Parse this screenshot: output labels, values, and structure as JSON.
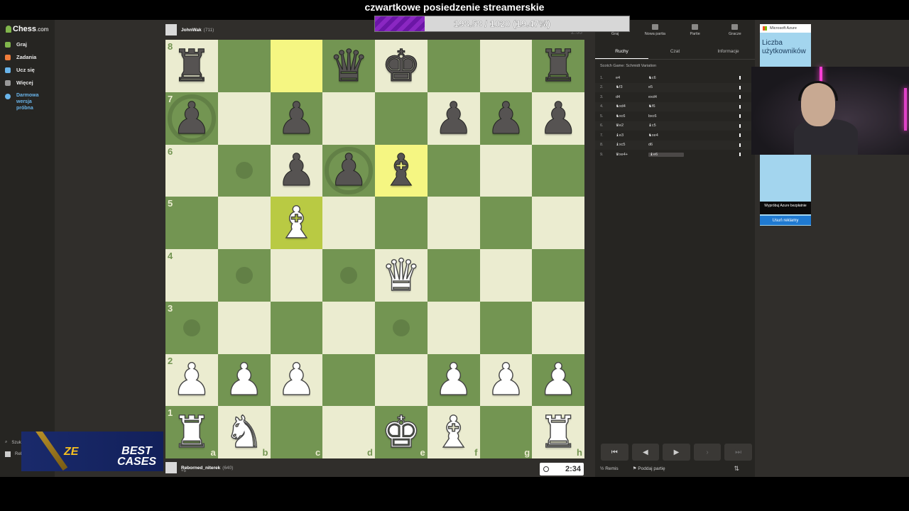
{
  "stream": {
    "title": "czwartkowe posiedzenie streamerskie",
    "goal_text": "198.58 / 1020 (19.47%)",
    "goal_fraction": 0.1947
  },
  "nav": {
    "logo": "Chess",
    "logo_suffix": ".com",
    "items": [
      {
        "label": "Graj",
        "color": "#81b64c"
      },
      {
        "label": "Zadania",
        "color": "#f07d3b"
      },
      {
        "label": "Ucz się",
        "color": "#69b4ea"
      },
      {
        "label": "Więcej",
        "color": "#999999"
      }
    ],
    "free_trial": "Darmowa\nwersja\npróbna",
    "search": "Szuk",
    "user_short": "Reb"
  },
  "top_player": {
    "name": "JohnWak",
    "rating": "(711)",
    "clock_hint": "2:55"
  },
  "bottom_player": {
    "name": "Reborned_niterek",
    "rating": "(640)",
    "sub": "+5",
    "clock": "2:34"
  },
  "board": {
    "files": [
      "a",
      "b",
      "c",
      "d",
      "e",
      "f",
      "g",
      "h"
    ],
    "ranks": [
      "8",
      "7",
      "6",
      "5",
      "4",
      "3",
      "2",
      "1"
    ],
    "rows": [
      [
        "br",
        "",
        "",
        "bq",
        "bk",
        "",
        "",
        "br"
      ],
      [
        "bp",
        "",
        "bp",
        "",
        "",
        "bp",
        "bp",
        "bp"
      ],
      [
        "",
        "",
        "bp",
        "bp",
        "bb",
        "",
        "",
        ""
      ],
      [
        "",
        "",
        "wb",
        "",
        "",
        "",
        "",
        ""
      ],
      [
        "",
        "",
        "",
        "",
        "wq",
        "",
        "",
        ""
      ],
      [
        "",
        "",
        "",
        "",
        "",
        "",
        "",
        ""
      ],
      [
        "wp",
        "wp",
        "wp",
        "",
        "",
        "wp",
        "wp",
        "wp"
      ],
      [
        "wr",
        "wn",
        "",
        "",
        "wk",
        "wb",
        "",
        "wr"
      ]
    ],
    "highlights": [
      "c8",
      "e6",
      "c5"
    ],
    "hints": [
      "b6",
      "b4",
      "d4",
      "a3",
      "e3"
    ],
    "rings": [
      "a7",
      "d6"
    ]
  },
  "panel": {
    "tabs": [
      "Graj",
      "Nowa partia",
      "Partie",
      "Gracze"
    ],
    "subtabs": [
      "Ruchy",
      "Czat",
      "Informacje"
    ],
    "opening": "Scotch Game: Schmidt Variation",
    "moves": [
      {
        "n": "1.",
        "w": "e4",
        "b": "♞c6"
      },
      {
        "n": "2.",
        "w": "♞f3",
        "b": "e5"
      },
      {
        "n": "3.",
        "w": "d4",
        "b": "exd4"
      },
      {
        "n": "4.",
        "w": "♞xd4",
        "b": "♞f6"
      },
      {
        "n": "5.",
        "w": "♞xc6",
        "b": "bxc6"
      },
      {
        "n": "6.",
        "w": "♛e2",
        "b": "♝c5"
      },
      {
        "n": "7.",
        "w": "♝e3",
        "b": "♞xe4"
      },
      {
        "n": "8.",
        "w": "♝xc5",
        "b": "d6"
      },
      {
        "n": "9.",
        "w": "♛xe4+",
        "b": "♝e6"
      }
    ],
    "controls": [
      "⏮",
      "◀",
      "▶",
      "›",
      "⏭"
    ],
    "draw": "Remis",
    "resign": "Poddaj partię"
  },
  "ad": {
    "brand": "Microsoft Azure",
    "headline": "Liczba użytkowników",
    "cta": "Wypróbuj Azure bezpłatnie",
    "remove": "Usuń reklamy"
  },
  "promo": {
    "word1": "ZE",
    "word2": "BEST CASES"
  }
}
